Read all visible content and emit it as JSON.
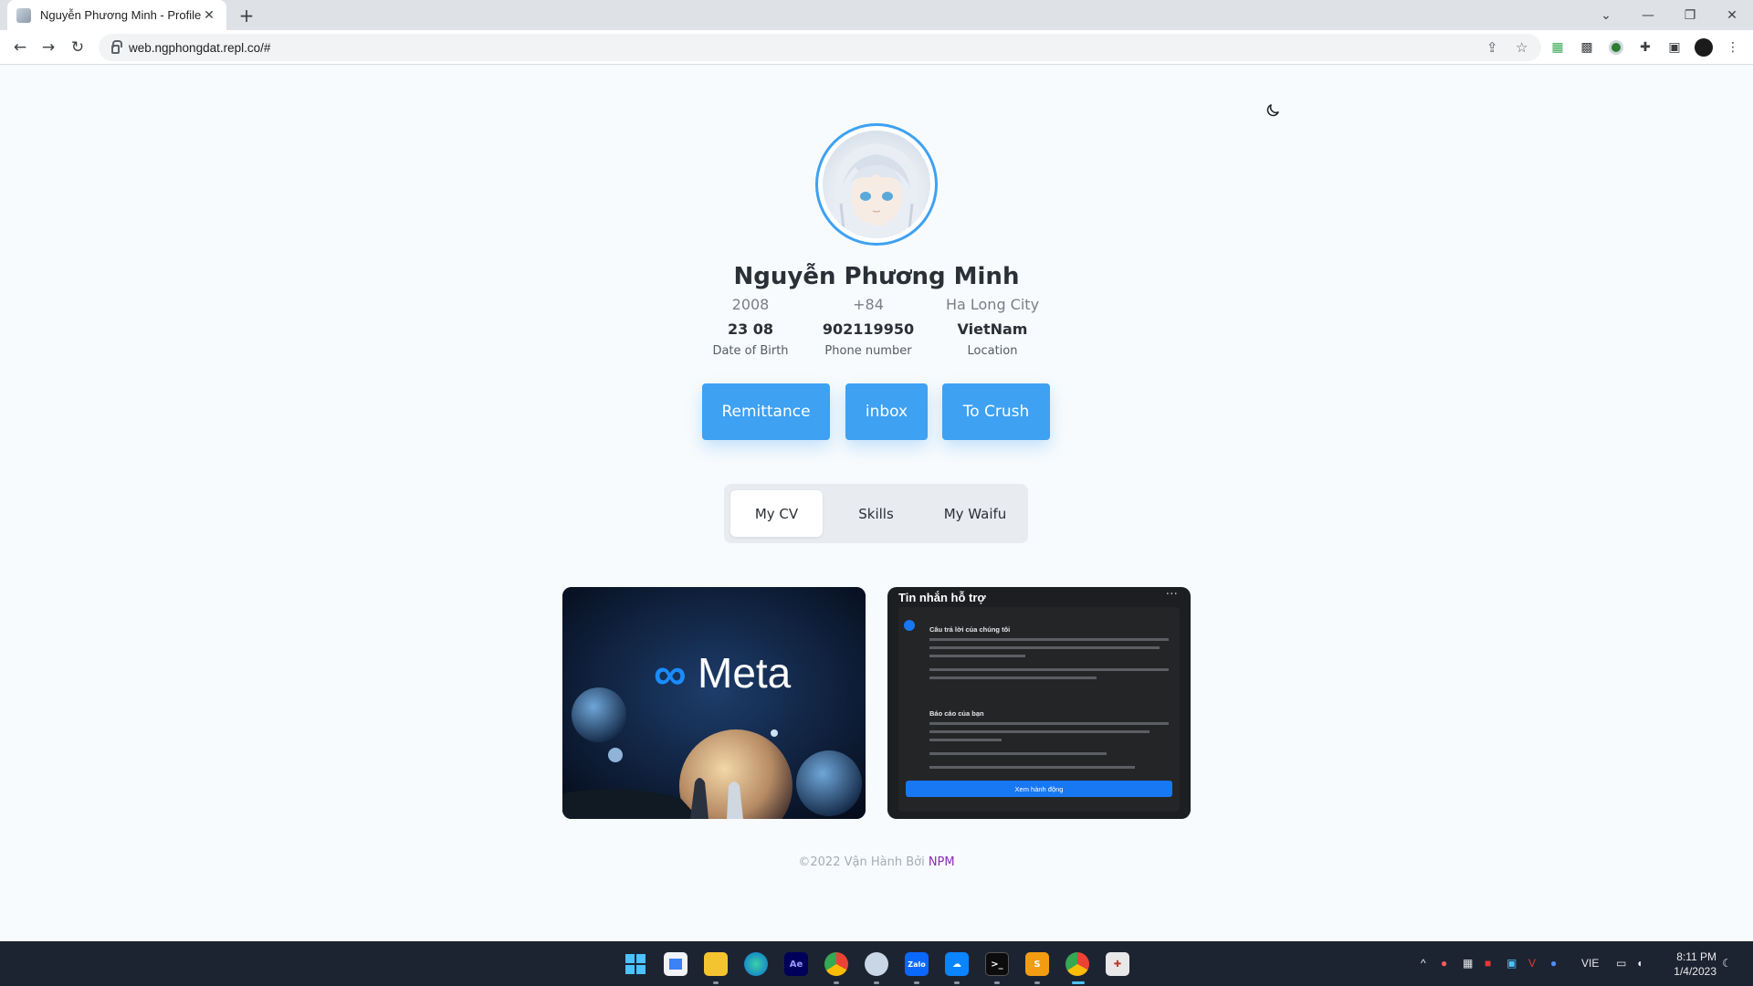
{
  "browser": {
    "tab_title": "Nguyễn Phương Minh - Profile",
    "url": "web.ngphongdat.repl.co/#"
  },
  "profile": {
    "name": "Nguyễn Phương Minh",
    "info": [
      {
        "sub": "2008",
        "main": "23 08",
        "label": "Date of Birth"
      },
      {
        "sub": "+84",
        "main": "902119950",
        "label": "Phone number"
      },
      {
        "sub": "Ha Long City",
        "main": "VietNam",
        "label": "Location"
      }
    ]
  },
  "actions": {
    "remittance": "Remittance",
    "inbox": "inbox",
    "to_crush": "To Crush"
  },
  "tabs": {
    "active": "My CV",
    "items": [
      "My CV",
      "Skills",
      "My Waifu"
    ]
  },
  "gallery": {
    "meta_text": "Meta",
    "support_title": "Tin nhắn hỗ trợ",
    "support_heading1": "Câu trả lời của chúng tôi",
    "support_heading2": "Báo cáo của bạn",
    "support_button": "Xem hành động"
  },
  "footer": {
    "text": "©2022 Vận Hành Bởi ",
    "link": "NPM"
  },
  "system": {
    "lang": "VIE",
    "time": "8:11 PM",
    "date": "1/4/2023"
  },
  "colors": {
    "accent": "#3ea1f2",
    "footer_link": "#8e2bb6"
  }
}
